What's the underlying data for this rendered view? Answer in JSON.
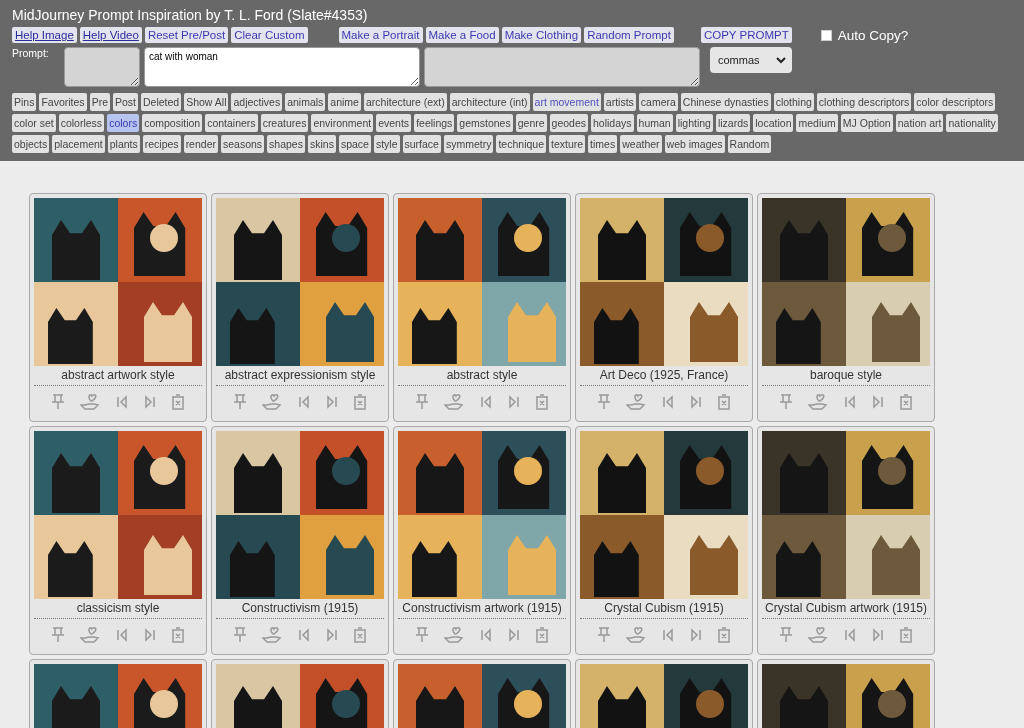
{
  "title": "MidJourney Prompt Inspiration by T. L. Ford (Slate#4353)",
  "top_buttons": [
    {
      "label": "Help Image",
      "kind": "link"
    },
    {
      "label": "Help Video",
      "kind": "link"
    },
    {
      "label": "Reset Pre/Post",
      "kind": "action"
    },
    {
      "label": "Clear Custom",
      "kind": "action"
    },
    {
      "label": "Make a Portrait",
      "kind": "make"
    },
    {
      "label": "Make a Food",
      "kind": "make"
    },
    {
      "label": "Make Clothing",
      "kind": "make"
    },
    {
      "label": "Random Prompt",
      "kind": "make"
    }
  ],
  "copy_button": "COPY PROMPT",
  "auto_copy": {
    "label": "Auto Copy?",
    "checked": false
  },
  "prompt": {
    "label": "Prompt:",
    "value": "cat with woman"
  },
  "separator": {
    "value": "commas"
  },
  "tags": [
    {
      "label": "Pins",
      "selected": false,
      "marked": false
    },
    {
      "label": "Favorites",
      "selected": false,
      "marked": false
    },
    {
      "label": "Pre",
      "selected": false,
      "marked": false
    },
    {
      "label": "Post",
      "selected": false,
      "marked": false
    },
    {
      "label": "Deleted",
      "selected": false,
      "marked": false
    },
    {
      "label": "Show All",
      "selected": false,
      "marked": false
    },
    {
      "label": "adjectives",
      "selected": false,
      "marked": false
    },
    {
      "label": "animals",
      "selected": false,
      "marked": false
    },
    {
      "label": "anime",
      "selected": false,
      "marked": false
    },
    {
      "label": "architecture (ext)",
      "selected": false,
      "marked": false
    },
    {
      "label": "architecture (int)",
      "selected": false,
      "marked": false
    },
    {
      "label": "art movement",
      "selected": false,
      "marked": true
    },
    {
      "label": "artists",
      "selected": false,
      "marked": false
    },
    {
      "label": "camera",
      "selected": false,
      "marked": false
    },
    {
      "label": "Chinese dynasties",
      "selected": false,
      "marked": false
    },
    {
      "label": "clothing",
      "selected": false,
      "marked": false
    },
    {
      "label": "clothing descriptors",
      "selected": false,
      "marked": false
    },
    {
      "label": "color descriptors",
      "selected": false,
      "marked": false
    },
    {
      "label": "color set",
      "selected": false,
      "marked": false
    },
    {
      "label": "colorless",
      "selected": false,
      "marked": false
    },
    {
      "label": "colors",
      "selected": true,
      "marked": false
    },
    {
      "label": "composition",
      "selected": false,
      "marked": false
    },
    {
      "label": "containers",
      "selected": false,
      "marked": false
    },
    {
      "label": "creatures",
      "selected": false,
      "marked": false
    },
    {
      "label": "environment",
      "selected": false,
      "marked": false
    },
    {
      "label": "events",
      "selected": false,
      "marked": false
    },
    {
      "label": "feelings",
      "selected": false,
      "marked": false
    },
    {
      "label": "gemstones",
      "selected": false,
      "marked": false
    },
    {
      "label": "genre",
      "selected": false,
      "marked": false
    },
    {
      "label": "geodes",
      "selected": false,
      "marked": false
    },
    {
      "label": "holidays",
      "selected": false,
      "marked": false
    },
    {
      "label": "human",
      "selected": false,
      "marked": false
    },
    {
      "label": "lighting",
      "selected": false,
      "marked": false
    },
    {
      "label": "lizards",
      "selected": false,
      "marked": false
    },
    {
      "label": "location",
      "selected": false,
      "marked": false
    },
    {
      "label": "medium",
      "selected": false,
      "marked": false
    },
    {
      "label": "MJ Option",
      "selected": false,
      "marked": false
    },
    {
      "label": "nation art",
      "selected": false,
      "marked": false
    },
    {
      "label": "nationality",
      "selected": false,
      "marked": false
    },
    {
      "label": "objects",
      "selected": false,
      "marked": false
    },
    {
      "label": "placement",
      "selected": false,
      "marked": false
    },
    {
      "label": "plants",
      "selected": false,
      "marked": false
    },
    {
      "label": "recipes",
      "selected": false,
      "marked": false
    },
    {
      "label": "render",
      "selected": false,
      "marked": false
    },
    {
      "label": "seasons",
      "selected": false,
      "marked": false
    },
    {
      "label": "shapes",
      "selected": false,
      "marked": false
    },
    {
      "label": "skins",
      "selected": false,
      "marked": false
    },
    {
      "label": "space",
      "selected": false,
      "marked": false
    },
    {
      "label": "style",
      "selected": false,
      "marked": false
    },
    {
      "label": "surface",
      "selected": false,
      "marked": false
    },
    {
      "label": "symmetry",
      "selected": false,
      "marked": false
    },
    {
      "label": "technique",
      "selected": false,
      "marked": false
    },
    {
      "label": "texture",
      "selected": false,
      "marked": false
    },
    {
      "label": "times",
      "selected": false,
      "marked": false
    },
    {
      "label": "weather",
      "selected": false,
      "marked": false
    },
    {
      "label": "web images",
      "selected": false,
      "marked": false
    },
    {
      "label": "Random",
      "selected": false,
      "marked": false
    }
  ],
  "cards": [
    {
      "caption": "abstract artwork style"
    },
    {
      "caption": "abstract expressionism style"
    },
    {
      "caption": "abstract style"
    },
    {
      "caption": "Art Deco (1925, France)"
    },
    {
      "caption": "baroque style"
    },
    {
      "caption": "classicism style"
    },
    {
      "caption": "Constructivism (1915)"
    },
    {
      "caption": "Constructivism artwork (1915)"
    },
    {
      "caption": "Crystal Cubism (1915)"
    },
    {
      "caption": "Crystal Cubism artwork (1915)"
    },
    {
      "kind": "picture"
    },
    {
      "kind": "picture"
    },
    {
      "kind": "picture"
    },
    {
      "kind": "picture"
    },
    {
      "kind": "picture"
    }
  ]
}
